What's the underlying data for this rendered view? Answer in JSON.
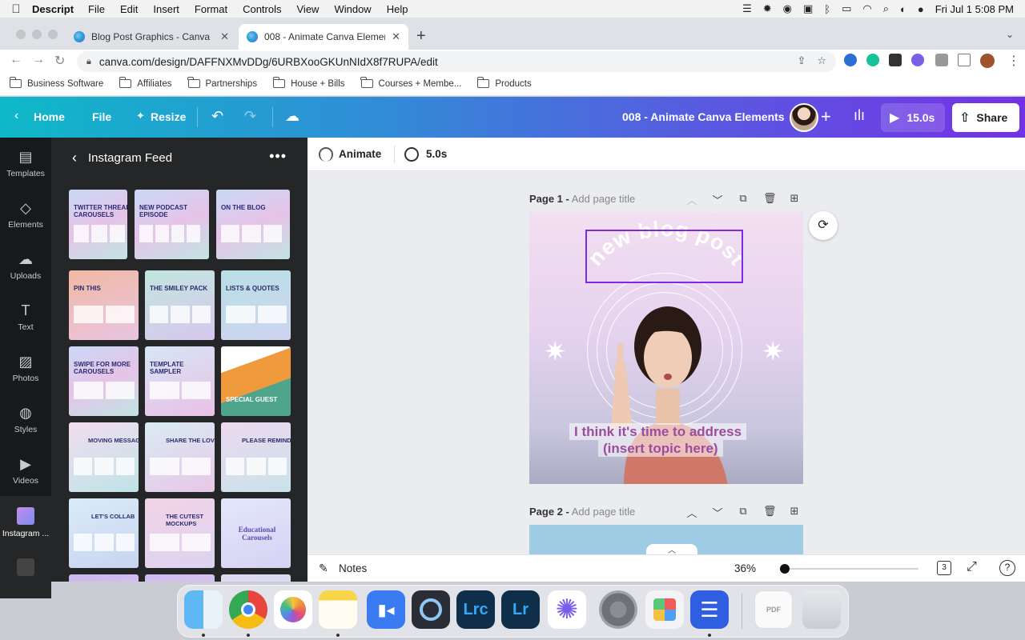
{
  "menubar": {
    "apple": "",
    "app": "Descript",
    "items": [
      "File",
      "Edit",
      "Insert",
      "Format",
      "Controls",
      "View",
      "Window",
      "Help"
    ],
    "clock": "Fri Jul 1  5:08 PM"
  },
  "browser": {
    "tabs": [
      {
        "label": "Blog Post Graphics - Canva",
        "close": "✕"
      },
      {
        "label": "008 - Animate Canva Elements",
        "close": "✕"
      }
    ],
    "new_tab": "+",
    "url": "canva.com/design/DAFFNXMvDDg/6URBXooGKUnNIdX8f7RUPA/edit",
    "bookmarks": [
      "Business Software",
      "Affiliates",
      "Partnerships",
      "House + Bills",
      "Courses + Membe...",
      "Products"
    ]
  },
  "canva_header": {
    "home": "Home",
    "file": "File",
    "resize": "Resize",
    "title": "008 - Animate Canva Elements",
    "play_duration": "15.0s",
    "share": "Share"
  },
  "rail": {
    "items": [
      "Templates",
      "Elements",
      "Uploads",
      "Text",
      "Photos",
      "Styles",
      "Videos",
      "Instagram ..."
    ]
  },
  "panel": {
    "title": "Instagram Feed",
    "thumbs": [
      "TWITTER THREAD CAROUSELS",
      "NEW PODCAST EPISODE",
      "ON THE BLOG",
      "PIN THIS",
      "THE SMILEY PACK",
      "LISTS & QUOTES",
      "SWIPE FOR MORE CAROUSELS",
      "TEMPLATE SAMPLER",
      "SPECIAL GUEST",
      "MOVING MESSAGES",
      "SHARE THE LOVE",
      "PLEASE REMIND ME",
      "LET'S COLLAB",
      "THE CUTEST MOCKUPS",
      "Educational Carousels"
    ]
  },
  "editor": {
    "animate": "Animate",
    "duration": "5.0s",
    "page1_label": "Page 1 -",
    "page1_placeholder": "Add page title",
    "page2_label": "Page 2 -",
    "page2_placeholder": "Add page title",
    "headline": "new blog post",
    "caption_line1": "I think it's time to address",
    "caption_line2": "(insert topic here)",
    "notes": "Notes",
    "zoom": "36%",
    "zoom_level": 0.36,
    "page_count": "3"
  },
  "colors": {
    "selection": "#7d2ae8",
    "caption_text": "#9b4c9e",
    "header_start": "#0fb8c9",
    "header_end": "#7431e6"
  }
}
